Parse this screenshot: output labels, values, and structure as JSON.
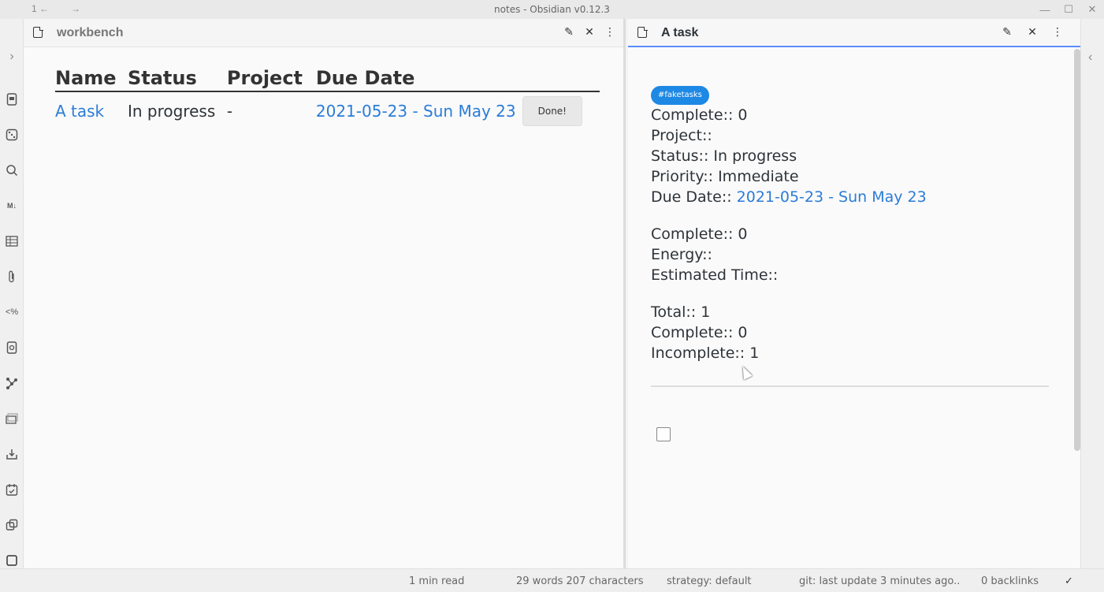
{
  "window": {
    "title": "notes - Obsidian v0.12.3",
    "nav_back_count": "1 ←",
    "nav_forward": "→",
    "minimize": "—",
    "maximize": "☐",
    "close": "✕"
  },
  "ribbon": {
    "expand": "›",
    "icons": [
      "file-icon",
      "dice-icon",
      "search-icon",
      "markdown-icon",
      "table-icon",
      "paperclip-icon",
      "template-icon",
      "doc-search-icon",
      "graph-icon",
      "cards-icon",
      "import-icon",
      "calendar-check-icon",
      "copy-icon",
      "square-icon"
    ],
    "template_label": "<%",
    "markdown_label": "M↓"
  },
  "left_pane": {
    "title": "workbench",
    "edit_icon": "✎",
    "close_icon": "✕",
    "more_icon": "⋮",
    "table": {
      "headers": [
        "Name",
        "Status",
        "Project",
        "Due Date"
      ],
      "rows": [
        {
          "name": "A task",
          "status": "In progress",
          "project": "-",
          "due": "2021-05-23 - Sun May 23",
          "action": "Done!"
        }
      ]
    }
  },
  "right_pane": {
    "title": "A task",
    "edit_icon": "✎",
    "close_icon": "✕",
    "more_icon": "⋮",
    "tag": "#faketasks",
    "block1": {
      "complete": "Complete:: 0",
      "project": "Project::",
      "status": "Status:: In progress",
      "priority": "Priority:: Immediate",
      "due_label": "Due Date:: ",
      "due_value": "2021-05-23 - Sun May 23"
    },
    "block2": {
      "complete": "Complete:: 0",
      "energy": "Energy::",
      "estimated": "Estimated Time::"
    },
    "block3": {
      "total": "Total:: 1",
      "complete": "Complete:: 0",
      "incomplete": "Incomplete:: 1"
    }
  },
  "right_rail": {
    "collapse": "‹"
  },
  "status_bar": {
    "read_time": "1 min read",
    "counts": "29 words 207 characters",
    "strategy": "strategy: default",
    "git": "git: last update 3 minutes ago..",
    "backlinks": "0 backlinks",
    "sync": "✓"
  }
}
